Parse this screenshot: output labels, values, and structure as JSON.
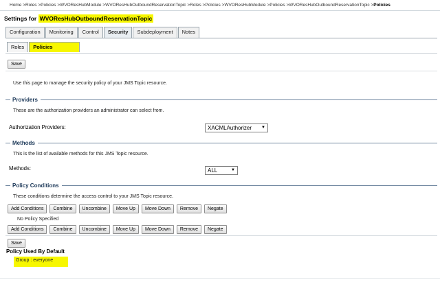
{
  "breadcrumb": {
    "path": "Home >Roles >Policies >WVOResHubModule >WVOResHubOutboundReservationTopic >Roles >Policies >WVOResHubModule >Policies >WVOResHubOutboundReservationTopic >",
    "current": "Policies"
  },
  "settings": {
    "prefix": "Settings for",
    "resource": "WVOResHubOutboundReservationTopic"
  },
  "tabs": [
    "Configuration",
    "Monitoring",
    "Control",
    "Security",
    "Subdeployment",
    "Notes"
  ],
  "subtabs": [
    "Roles",
    "Policies"
  ],
  "save_label": "Save",
  "intro_text": "Use this page to manage the security policy of your JMS Topic resource.",
  "providers": {
    "title": "Providers",
    "desc": "These are the authorization providers an administrator can select from.",
    "label": "Authorization Providers:",
    "value": "XACMLAuthorizer"
  },
  "methods": {
    "title": "Methods",
    "desc": "This is the list of available methods for this JMS Topic resource.",
    "label": "Methods:",
    "value": "ALL"
  },
  "policy_conditions": {
    "title": "Policy Conditions",
    "desc": "These conditions determine the access control to your JMS Topic resource.",
    "buttons": [
      "Add Conditions",
      "Combine",
      "Uncombine",
      "Move Up",
      "Move Down",
      "Remove",
      "Negate"
    ],
    "empty_text": "No Policy Specified"
  },
  "default_policy": {
    "title": "Policy Used By Default",
    "value": "Group : everyone"
  },
  "colors": {
    "highlight": "#f7f700",
    "section_title": "#1e3a5a",
    "rule": "#6f86a0"
  }
}
